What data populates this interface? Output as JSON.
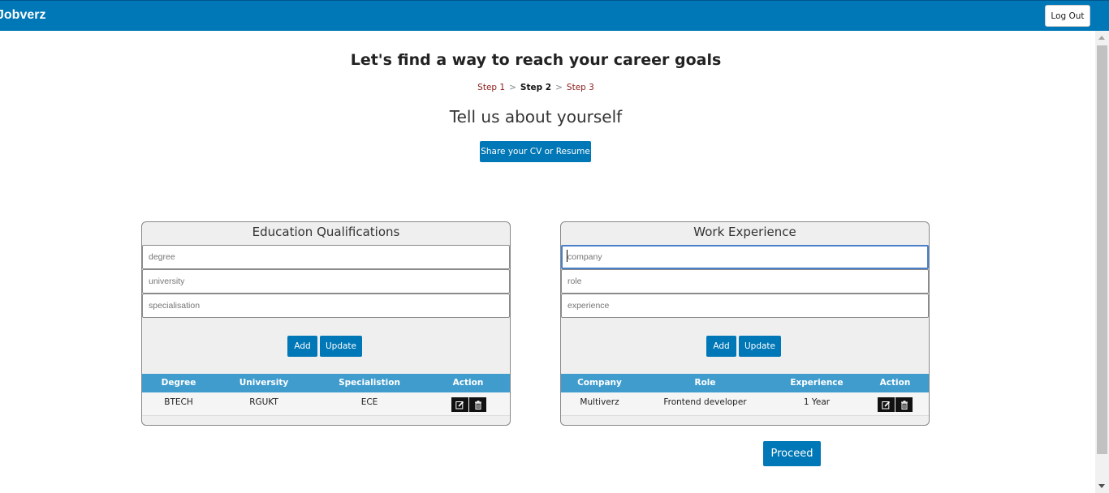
{
  "header": {
    "brand": "Jobverz",
    "logout_label": "Log Out"
  },
  "main": {
    "title": "Let's find a way to reach your career goals",
    "steps": [
      {
        "label": "Step 1",
        "state": "link"
      },
      {
        "label": "Step 2",
        "state": "current"
      },
      {
        "label": "Step 3",
        "state": "link"
      }
    ],
    "step_separator": ">",
    "subtitle": "Tell us about yourself",
    "share_label": "Share your CV or Resume",
    "proceed_label": "Proceed"
  },
  "education": {
    "title": "Education Qualifications",
    "fields": [
      {
        "placeholder": "degree",
        "value": ""
      },
      {
        "placeholder": "university",
        "value": ""
      },
      {
        "placeholder": "specialisation",
        "value": ""
      }
    ],
    "add_label": "Add",
    "update_label": "Update",
    "columns": [
      "Degree",
      "University",
      "Specialistion",
      "Action"
    ],
    "rows": [
      {
        "degree": "BTECH",
        "university": "RGUKT",
        "specialisation": "ECE"
      }
    ]
  },
  "work": {
    "title": "Work Experience",
    "fields": [
      {
        "placeholder": "company",
        "value": ""
      },
      {
        "placeholder": "role",
        "value": ""
      },
      {
        "placeholder": "experience",
        "value": ""
      }
    ],
    "add_label": "Add",
    "update_label": "Update",
    "columns": [
      "Company",
      "Role",
      "Experience",
      "Action"
    ],
    "rows": [
      {
        "company": "Multiverz",
        "role": "Frontend developer",
        "experience": "1 Year"
      }
    ]
  },
  "colors": {
    "primary": "#0077b6",
    "table_header": "#3f9ccd",
    "step_link": "#8b1a1a"
  },
  "icons": [
    "edit-icon",
    "trash-icon",
    "scroll-up-arrow-icon",
    "scroll-down-arrow-icon"
  ]
}
